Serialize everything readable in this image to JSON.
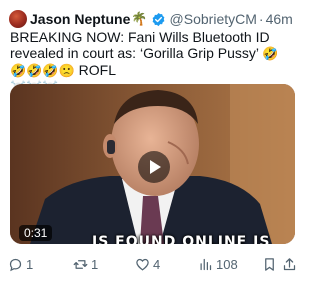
{
  "tweet": {
    "author_name": "Jason Neptune",
    "author_emoji": "🌴",
    "handle": "@SobrietyCM",
    "separator": "·",
    "time": "46m",
    "text_main": "BREAKING NOW: Fani Wills Bluetooth ID revealed in court as: ‘Gorilla Grip Pussy’ ",
    "text_emojis": "🤣🤣🤣🤣🙁",
    "text_tail": " ROFL",
    "text_skulls": "☠️☠️☠️"
  },
  "media": {
    "duration": "0:31",
    "caption": "IS FOUND ONLINE IS"
  },
  "actions": {
    "replies": "1",
    "reposts": "1",
    "likes": "4",
    "views": "108"
  },
  "icons": [
    "avatar",
    "verified-badge-icon",
    "play-icon",
    "reply-icon",
    "repost-icon",
    "like-icon",
    "views-icon",
    "bookmark-icon",
    "share-icon"
  ],
  "colors": {
    "verified": "#1d9bf0",
    "muted": "#536471",
    "text": "#0f1419"
  }
}
